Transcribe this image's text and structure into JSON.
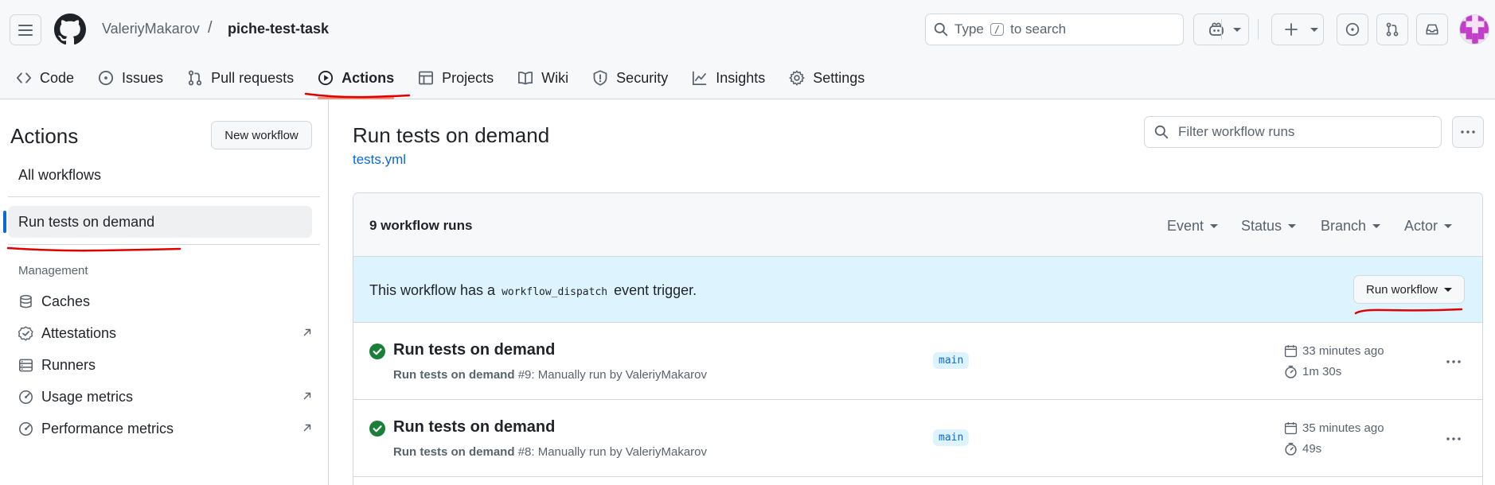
{
  "header": {
    "owner": "ValeriyMakarov",
    "separator": "/",
    "repo": "piche-test-task",
    "search_prefix": "Type",
    "search_key": "/",
    "search_suffix": "to search"
  },
  "repo_nav": [
    {
      "label": "Code",
      "icon": "code-icon"
    },
    {
      "label": "Issues",
      "icon": "issue-opened-icon"
    },
    {
      "label": "Pull requests",
      "icon": "git-pull-request-icon"
    },
    {
      "label": "Actions",
      "icon": "play-icon",
      "active": true
    },
    {
      "label": "Projects",
      "icon": "table-icon"
    },
    {
      "label": "Wiki",
      "icon": "book-icon"
    },
    {
      "label": "Security",
      "icon": "shield-icon"
    },
    {
      "label": "Insights",
      "icon": "graph-icon"
    },
    {
      "label": "Settings",
      "icon": "gear-icon"
    }
  ],
  "sidebar": {
    "title": "Actions",
    "new_workflow": "New workflow",
    "all_workflows": "All workflows",
    "selected_workflow": "Run tests on demand",
    "management_label": "Management",
    "management_items": [
      {
        "label": "Caches",
        "icon": "database-icon",
        "external": false
      },
      {
        "label": "Attestations",
        "icon": "verified-icon",
        "external": true
      },
      {
        "label": "Runners",
        "icon": "server-icon",
        "external": false
      },
      {
        "label": "Usage metrics",
        "icon": "meter-icon",
        "external": true
      },
      {
        "label": "Performance metrics",
        "icon": "meter-icon",
        "external": true
      }
    ]
  },
  "main": {
    "title": "Run tests on demand",
    "file": "tests.yml",
    "filter_placeholder": "Filter workflow runs",
    "runs_count": "9 workflow runs",
    "filters": [
      "Event",
      "Status",
      "Branch",
      "Actor"
    ],
    "dispatch_prefix": "This workflow has a",
    "dispatch_code": "workflow_dispatch",
    "dispatch_suffix": "event trigger.",
    "run_workflow_button": "Run workflow"
  },
  "runs": [
    {
      "title": "Run tests on demand",
      "sub_name": "Run tests on demand",
      "sub_detail": "#9: Manually run by ValeriyMakarov",
      "branch": "main",
      "time_ago": "33 minutes ago",
      "duration": "1m 30s",
      "status": "success"
    },
    {
      "title": "Run tests on demand",
      "sub_name": "Run tests on demand",
      "sub_detail": "#8: Manually run by ValeriyMakarov",
      "branch": "main",
      "time_ago": "35 minutes ago",
      "duration": "49s",
      "status": "success"
    }
  ],
  "colors": {
    "accent_blue": "#0969da",
    "success_green": "#1a7f37",
    "annotation_red": "#e00000",
    "nav_underline": "#fd8c73"
  }
}
